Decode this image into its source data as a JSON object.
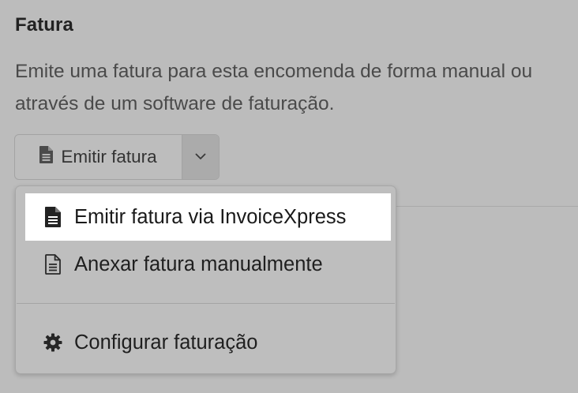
{
  "section": {
    "title": "Fatura",
    "description": "Emite uma fatura para esta encomenda de forma manual ou através de um software de faturação."
  },
  "split_button": {
    "label": "Emitir fatura",
    "icon": "document-icon",
    "toggle_icon": "chevron-down-icon"
  },
  "menu": {
    "items": [
      {
        "label": "Emitir fatura via InvoiceXpress",
        "icon": "document-filled-icon",
        "highlighted": true
      },
      {
        "label": "Anexar fatura manualmente",
        "icon": "document-outline-icon",
        "highlighted": false
      },
      {
        "label": "Configurar faturação",
        "icon": "gear-icon",
        "highlighted": false
      }
    ]
  },
  "colors": {
    "overlay_background": "#bcbcbc",
    "highlight": "#ffffff",
    "text": "#1f1f1f"
  }
}
